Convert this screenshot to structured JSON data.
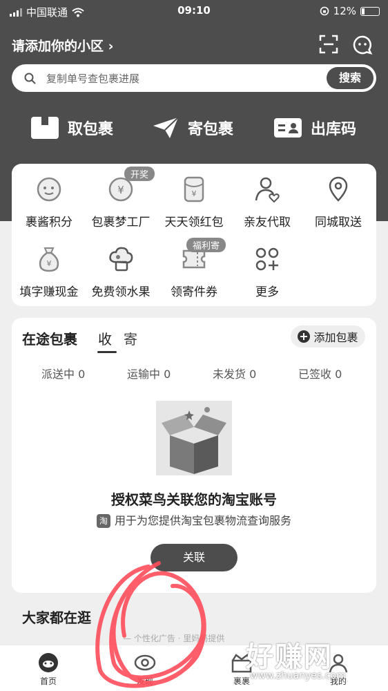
{
  "status_bar": {
    "carrier": "中国联通",
    "time": "09:10",
    "battery": "12%"
  },
  "header": {
    "location_title": "请添加你的小区 ›"
  },
  "search": {
    "placeholder": "复制单号查包裹进展",
    "button": "搜索"
  },
  "quick_actions": [
    {
      "label": "取包裹",
      "icon": "box-icon"
    },
    {
      "label": "寄包裹",
      "icon": "paper-plane-icon"
    },
    {
      "label": "出库码",
      "icon": "id-card-icon"
    }
  ],
  "services": [
    {
      "label": "裹酱积分",
      "icon": "mascot-icon"
    },
    {
      "label": "包裹梦工厂",
      "icon": "coin-icon",
      "tag": "开奖"
    },
    {
      "label": "天天领红包",
      "icon": "red-envelope-icon"
    },
    {
      "label": "亲友代取",
      "icon": "person-heart-icon"
    },
    {
      "label": "同城取送",
      "icon": "location-pin-icon"
    },
    {
      "label": "填字赚现金",
      "icon": "money-bag-icon"
    },
    {
      "label": "免费领水果",
      "icon": "fruit-tree-icon"
    },
    {
      "label": "领寄件券",
      "icon": "coupon-icon",
      "tag": "福利寄"
    },
    {
      "label": "更多",
      "icon": "grid-plus-icon"
    }
  ],
  "packages": {
    "title": "在途包裹",
    "tab_receive": "收",
    "tab_send": "寄",
    "add_button": "添加包裹",
    "stats": [
      "派送中 0",
      "运输中 0",
      "未发货 0",
      "已签收 0"
    ],
    "auth_title": "授权菜鸟关联您的淘宝账号",
    "auth_sub_badge": "淘",
    "auth_sub": "用于为您提供淘宝包裹物流查询服务",
    "link_button": "关联"
  },
  "browse": {
    "title": "大家都在逛",
    "ad_note": "— 个性化广告 · 里妈妈提供"
  },
  "tabbar": [
    {
      "label": "首页",
      "icon": "home-mascot-icon"
    },
    {
      "label": "发现",
      "icon": "eye-icon"
    },
    {
      "label": "裹裹",
      "icon": "gift-icon"
    },
    {
      "label": "我的",
      "icon": "user-icon"
    }
  ],
  "watermark": {
    "text": "好赚网",
    "url": "www.zhuanyes.com"
  },
  "colors": {
    "header": "#4d4d4d",
    "background": "#efefef",
    "card": "#ffffff",
    "annotation": "#ff4d5a"
  }
}
